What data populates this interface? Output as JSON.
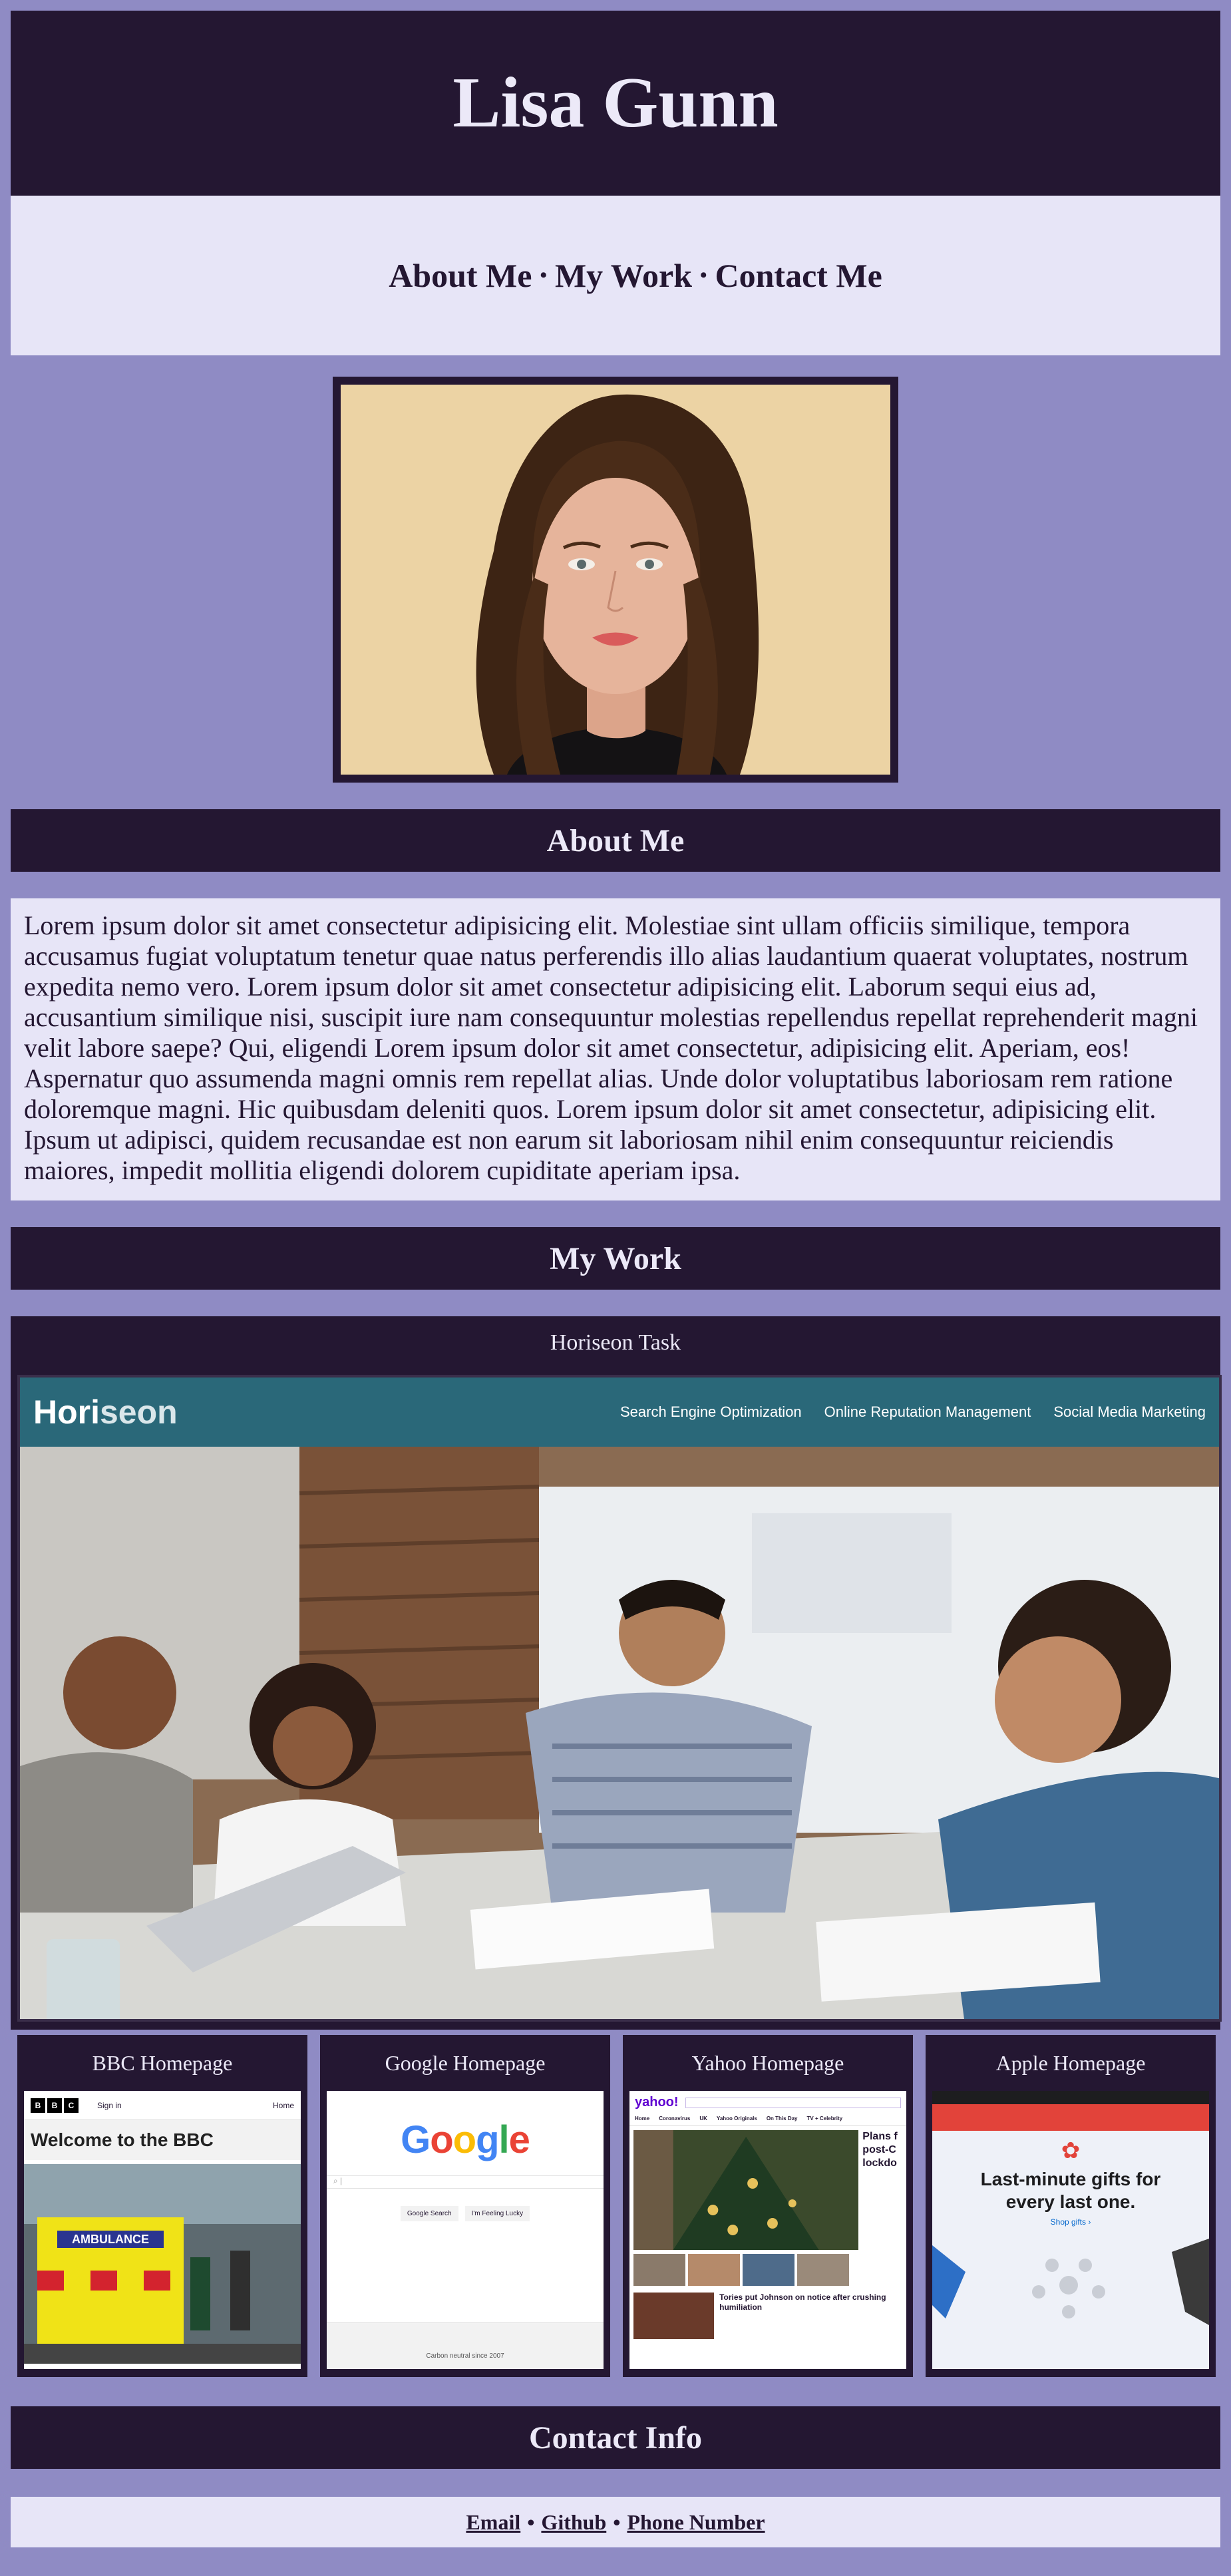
{
  "header": {
    "title": "Lisa Gunn"
  },
  "nav": {
    "items": [
      "About Me",
      "My Work",
      "Contact Me"
    ],
    "separator": "•"
  },
  "portrait": {
    "alt": "Portrait of Lisa Gunn"
  },
  "about": {
    "heading": "About Me",
    "text": "Lorem ipsum dolor sit amet consectetur adipisicing elit. Molestiae sint ullam officiis similique, tempora accusamus fugiat voluptatum tenetur quae natus perferendis illo alias laudantium quaerat voluptates, nostrum expedita nemo vero. Lorem ipsum dolor sit amet consectetur adipisicing elit. Laborum sequi eius ad, accusantium similique nisi, suscipit iure nam consequuntur molestias repellendus repellat reprehenderit magni velit labore saepe? Qui, eligendi Lorem ipsum dolor sit amet consectetur, adipisicing elit. Aperiam, eos! Aspernatur quo assumenda magni omnis rem repellat alias. Unde dolor voluptatibus laboriosam rem ratione doloremque magni. Hic quibusdam deleniti quos. Lorem ipsum dolor sit amet consectetur, adipisicing elit. Ipsum ut adipisci, quidem recusandae est non earum sit laboriosam nihil enim consequuntur reiciendis maiores, impedit mollitia eligendi dolorem cupiditate aperiam ipsa."
  },
  "work": {
    "heading": "My Work",
    "featured": {
      "title": "Horiseon Task",
      "logo_a": "Hori",
      "logo_b": "seon",
      "nav": [
        "Search Engine Optimization",
        "Online Reputation Management",
        "Social Media Marketing"
      ]
    },
    "projects": [
      {
        "title": "BBC Homepage",
        "sign_in": "Sign in",
        "home": "Home",
        "headline": "Welcome to the BBC",
        "sign": "AMBULANCE"
      },
      {
        "title": "Google Homepage",
        "logo": "Google",
        "btn_search": "Google Search",
        "btn_lucky": "I'm Feeling Lucky",
        "footer": "Carbon neutral since 2007"
      },
      {
        "title": "Yahoo Homepage",
        "logo": "yahoo!",
        "tabs": [
          "Home",
          "Coronavirus",
          "UK",
          "Yahoo Originals",
          "On This Day",
          "TV + Celebrity"
        ],
        "side_head": "Plans f post-C lockdo",
        "headline": "Tories put Johnson on notice after crushing humiliation"
      },
      {
        "title": "Apple Homepage",
        "headline1": "Last-minute gifts for",
        "headline2": "every last one.",
        "link": "Shop gifts ›"
      }
    ]
  },
  "contact": {
    "heading": "Contact Info",
    "links": [
      "Email",
      "Github",
      "Phone Number"
    ],
    "separator": "•"
  },
  "colors": {
    "page_bg": "#8f8bc4",
    "dark": "#241732",
    "light": "#e7e5f7",
    "horiseon_teal": "#2a6879"
  }
}
